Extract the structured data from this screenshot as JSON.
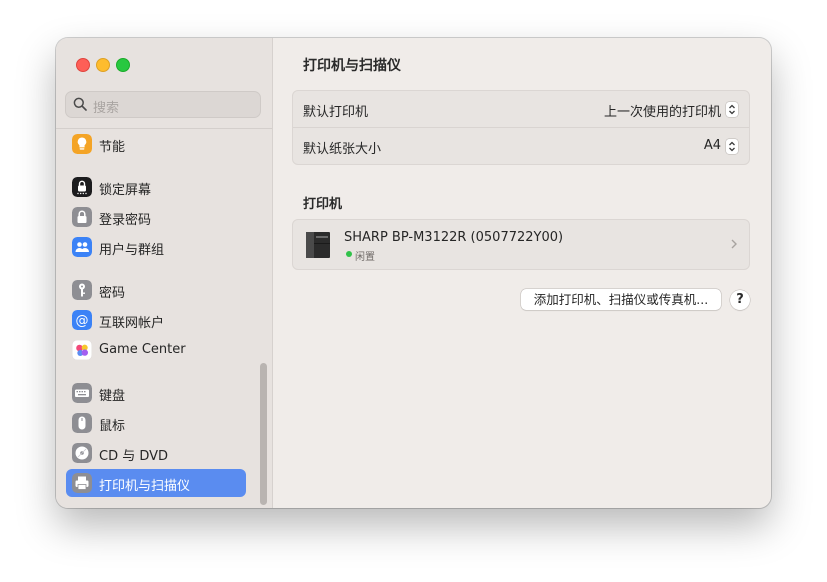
{
  "sidebar": {
    "search_placeholder": "搜索",
    "items": [
      {
        "label": "节能",
        "icon": "lightbulb-icon",
        "color": "#f4a426"
      },
      {
        "label": "锁定屏幕",
        "icon": "lock-screen-icon",
        "color": "#1c1c1e"
      },
      {
        "label": "登录密码",
        "icon": "lock-icon",
        "color": "#8e8e93"
      },
      {
        "label": "用户与群组",
        "icon": "users-icon",
        "color": "#3b82f6"
      },
      {
        "label": "密码",
        "icon": "key-icon",
        "color": "#8e8e93"
      },
      {
        "label": "互联网帐户",
        "icon": "at-sign-icon",
        "color": "#3b82f6"
      },
      {
        "label": "Game Center",
        "icon": "game-center-icon",
        "color": "#ffffff"
      },
      {
        "label": "键盘",
        "icon": "keyboard-icon",
        "color": "#8e8e93"
      },
      {
        "label": "鼠标",
        "icon": "mouse-icon",
        "color": "#8e8e93"
      },
      {
        "label": "CD 与 DVD",
        "icon": "disc-icon",
        "color": "#8e8e93"
      },
      {
        "label": "打印机与扫描仪",
        "icon": "printer-icon",
        "color": "#8e8e93"
      }
    ]
  },
  "main": {
    "title": "打印机与扫描仪",
    "defaults": [
      {
        "label": "默认打印机",
        "value": "上一次使用的打印机"
      },
      {
        "label": "默认纸张大小",
        "value": "A4"
      }
    ],
    "printers_section": "打印机",
    "printer": {
      "name": "SHARP BP-M3122R (0507722Y00)",
      "status": "闲置"
    },
    "add_button": "添加打印机、扫描仪或传真机...",
    "help_button": "?"
  },
  "colors": {
    "accent": "#5a8cf0",
    "status_idle": "#31c24a"
  }
}
